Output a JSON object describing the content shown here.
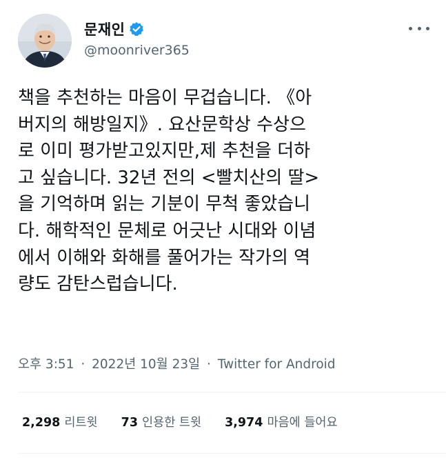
{
  "author": {
    "display_name": "문재인",
    "handle": "@moonriver365",
    "verified": true
  },
  "tweet": {
    "lines": [
      "책을 추천하는 마음이 무겁습니다. 《아",
      "버지의 해방일지》. 요산문학상 수상으",
      "로 이미 평가받고있지만,제 추천을 더하",
      "고 싶습니다. 32년 전의 <빨치산의 딸>",
      "을 기억하며 읽는 기분이 무척 좋았습니",
      "다. 해학적인 문체로 어긋난 시대와 이념",
      "에서 이해와 화해를 풀어가는 작가의 역",
      "량도 감탄스럽습니다."
    ]
  },
  "meta": {
    "time": "오후 3:51",
    "date": "2022년 10월 23일",
    "separator": "·",
    "source": "Twitter for Android"
  },
  "stats": {
    "retweets_count": "2,298",
    "retweets_label": "리트윗",
    "quotes_count": "73",
    "quotes_label": "인용한 트윗",
    "likes_count": "3,974",
    "likes_label": "마음에 들어요"
  },
  "icons": {
    "verified": "verified-badge-icon",
    "more": "more-options-icon"
  },
  "colors": {
    "text_primary": "#0f1419",
    "text_secondary": "#536471",
    "verified_blue": "#1d9bf0",
    "divider": "#eff3f4"
  }
}
